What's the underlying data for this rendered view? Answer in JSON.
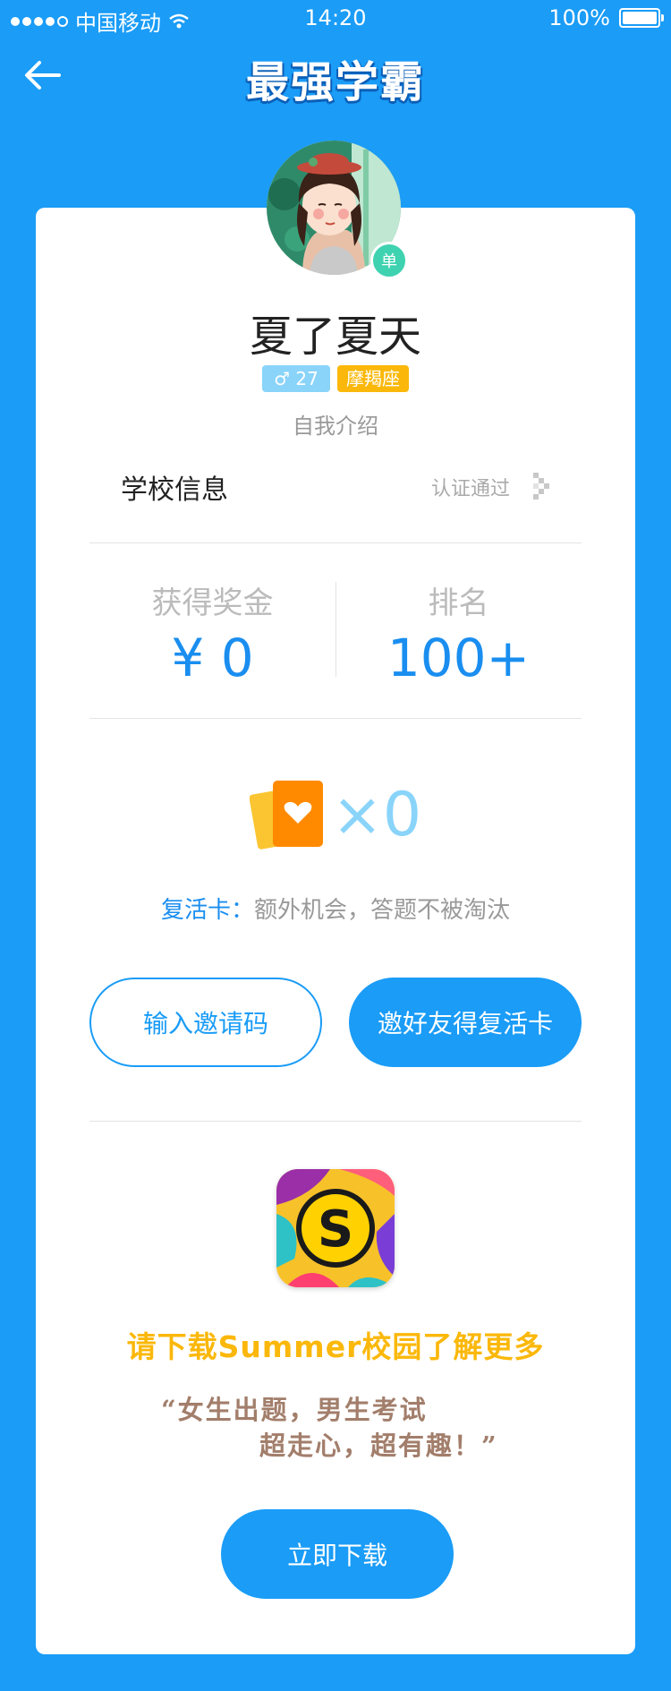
{
  "status_bar": {
    "carrier": "中国移动",
    "time": "14:20",
    "battery": "100%"
  },
  "header": {
    "title": "最强学霸"
  },
  "profile": {
    "name": "夏了夏天",
    "badge": "单",
    "gender_age": "♂ 27",
    "zodiac": "摩羯座",
    "intro": "自我介绍"
  },
  "school": {
    "label": "学校信息",
    "status": "认证通过"
  },
  "stats": {
    "bonus_label": "获得奖金",
    "bonus_value": "¥ 0",
    "rank_label": "排名",
    "rank_value": "100+"
  },
  "revive": {
    "count": "×0",
    "label": "复活卡：",
    "desc": "额外机会，答题不被淘汰"
  },
  "buttons": {
    "invite_code": "输入邀请码",
    "invite_friend": "邀好友得复活卡",
    "download": "立即下载"
  },
  "promo": {
    "headline": "请下载Summer校园了解更多",
    "slogan_line1": "“女生出题，男生考试",
    "slogan_line2": "超走心，超有趣！”",
    "app_letter": "S"
  },
  "colors": {
    "primary": "#1a9cf7",
    "accent_yellow": "#fbb80a",
    "badge_green": "#3ed2b0"
  }
}
